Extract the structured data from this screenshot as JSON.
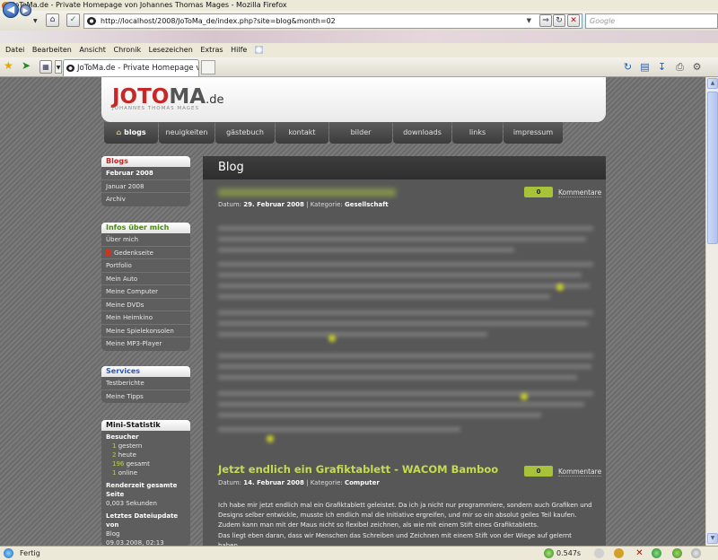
{
  "window": {
    "title": "JoToMa.de - Private Homepage von Johannes Thomas Mages - Mozilla Firefox"
  },
  "toolbar": {
    "url": "http://localhost/2008/JoToMa_de/index.php?site=blog&month=02",
    "search_placeholder": "Google"
  },
  "menu": [
    "Datei",
    "Bearbeiten",
    "Ansicht",
    "Chronik",
    "Lesezeichen",
    "Extras",
    "Hilfe"
  ],
  "tab": {
    "label": "JoToMa.de - Private Homepage von J..."
  },
  "site": {
    "logo": {
      "part1": "JOTO",
      "part2": "MA",
      "tld": ".de",
      "subtitle": "JOHANNES THOMAS MAGES"
    },
    "nav": [
      "blogs",
      "neuigkeiten",
      "gästebuch",
      "kontakt",
      "bilder",
      "downloads",
      "links",
      "impressum"
    ]
  },
  "sidebar": {
    "blogs": {
      "title": "Blogs",
      "items": [
        "Februar 2008",
        "Januar 2008",
        "Archiv"
      ]
    },
    "info": {
      "title": "Infos über mich",
      "items": [
        "Über mich",
        "Gedenkseite",
        "Portfolio",
        "Mein Auto",
        "Meine Computer",
        "Meine DVDs",
        "Mein Heimkino",
        "Meine Spielekonsolen",
        "Meine MP3-Player"
      ]
    },
    "services": {
      "title": "Services",
      "items": [
        "Testberichte",
        "Meine Tipps"
      ]
    },
    "stats": {
      "title": "Mini-Statistik",
      "visitors_label": "Besucher",
      "visitors": [
        {
          "num": "1",
          "label": "gestern"
        },
        {
          "num": "2",
          "label": "heute"
        },
        {
          "num": "196",
          "label": "gesamt"
        },
        {
          "num": "1",
          "label": "online"
        }
      ],
      "render_label": "Renderzeit gesamte Seite",
      "render_value": "0,003 Sekunden",
      "update_label": "Letztes Dateiupdate von",
      "update_value": "Blog",
      "update_date": "09.03.2008, 02:13"
    }
  },
  "main": {
    "heading": "Blog",
    "posts": [
      {
        "date_label": "Datum:",
        "date": "29. Februar 2008",
        "category_label": "Kategorie:",
        "category": "Gesellschaft",
        "comments": "0",
        "comments_label": "Kommentare"
      },
      {
        "title": "Jetzt endlich ein Grafiktablett - WACOM Bamboo",
        "date_label": "Datum:",
        "date": "14. Februar 2008",
        "category_label": "Kategorie:",
        "category": "Computer",
        "comments": "0",
        "comments_label": "Kommentare",
        "paragraph1": "Ich habe mir jetzt endlich mal ein Grafiktablett geleistet. Da ich ja nicht nur programmiere, sondern auch Grafiken und Designs selber entwickle, musste ich endlich mal die Initiative ergreifen, und mir so ein absolut geiles Teil kaufen. Zudem kann man mit der Maus nicht so flexibel zeichnen, als wie mit einem Stift eines Grafiktabletts.",
        "paragraph2": "Das liegt eben daran, dass wir Menschen das Schreiben und Zeichnen mit einem Stift von der Wiege auf gelernt haben."
      }
    ]
  },
  "status": {
    "text": "Fertig",
    "time": "0.547s"
  }
}
